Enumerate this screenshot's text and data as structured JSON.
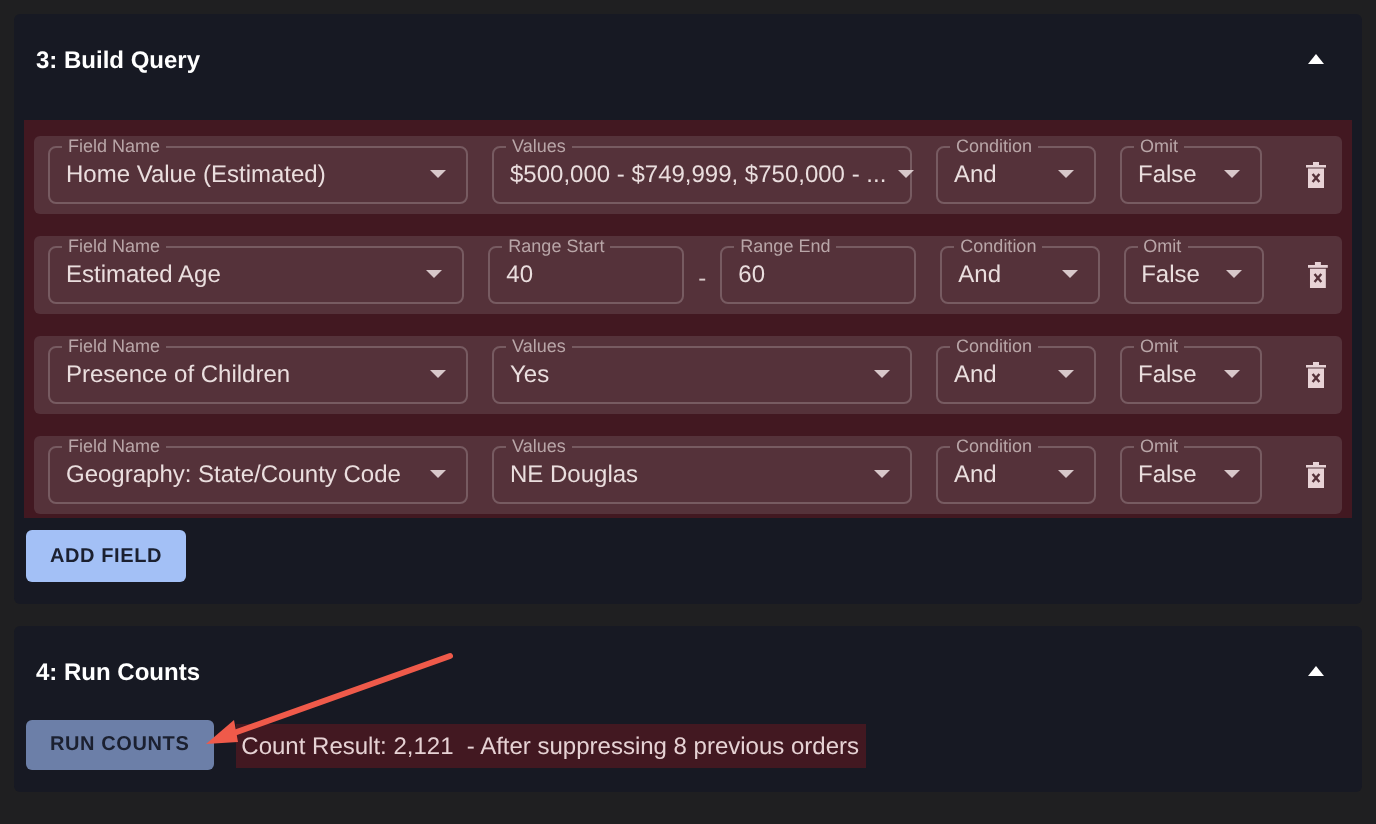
{
  "sections": [
    {
      "title": "3: Build Query",
      "expanded": true,
      "kind": "query",
      "rows": [
        {
          "kind": "values",
          "field_label": "Field Name",
          "field": "Home Value (Estimated)",
          "values_label": "Values",
          "values": "$500,000 - $749,999, $750,000 - ...",
          "condition_label": "Condition",
          "condition": "And",
          "omit_label": "Omit",
          "omit": "False"
        },
        {
          "kind": "range",
          "field_label": "Field Name",
          "field": "Estimated Age",
          "start_label": "Range Start",
          "start": "40",
          "separator": "-",
          "end_label": "Range End",
          "end": "60",
          "condition_label": "Condition",
          "condition": "And",
          "omit_label": "Omit",
          "omit": "False"
        },
        {
          "kind": "values",
          "field_label": "Field Name",
          "field": "Presence of Children",
          "values_label": "Values",
          "values": "Yes",
          "condition_label": "Condition",
          "condition": "And",
          "omit_label": "Omit",
          "omit": "False"
        },
        {
          "kind": "values",
          "field_label": "Field Name",
          "field": "Geography: State/County Code",
          "values_label": "Values",
          "values": "NE Douglas",
          "condition_label": "Condition",
          "condition": "And",
          "omit_label": "Omit",
          "omit": "False"
        }
      ],
      "button": "ADD FIELD"
    },
    {
      "title": "4: Run Counts",
      "expanded": true,
      "kind": "counts",
      "button": "RUN COUNTS",
      "result": "Count Result: 2,121  - After suppressing 8 previous orders"
    }
  ]
}
